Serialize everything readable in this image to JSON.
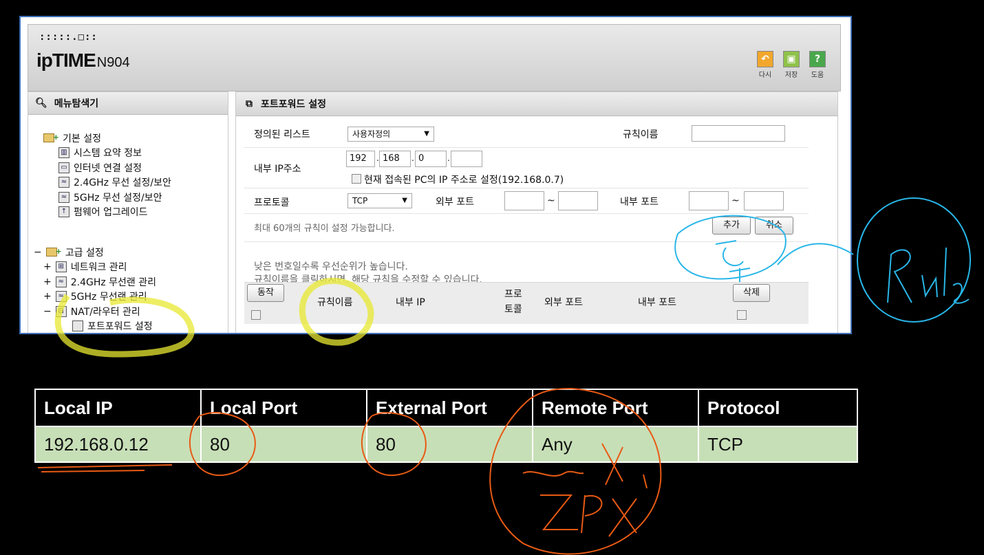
{
  "router": {
    "logo_small": ":::::.□::",
    "brand": "ipTIME",
    "model": "N904",
    "toolbar": [
      {
        "label": "다시",
        "icon": "undo-icon"
      },
      {
        "label": "저장",
        "icon": "save-icon"
      },
      {
        "label": "도움",
        "icon": "help-icon"
      }
    ],
    "menu_title": "메뉴탐색기",
    "menu": {
      "basic": {
        "label": "기본 설정",
        "items": [
          "시스템 요약 정보",
          "인터넷 연결 설정",
          "2.4GHz 무선 설정/보안",
          "5GHz 무선 설정/보안",
          "펌웨어 업그레이드"
        ]
      },
      "advanced": {
        "label": "고급 설정",
        "items": [
          "네트워크 관리",
          "2.4GHz 무선랜 관리",
          "5GHz 무선랜 관리",
          "NAT/라우터 관리"
        ],
        "sub_item": "포트포워드 설정"
      }
    },
    "panel_title": "포트포워드 설정",
    "form": {
      "predefined_label": "정의된 리스트",
      "predefined_value": "사용자정의",
      "rule_name_label": "규칙이름",
      "internal_ip_label": "내부 IP주소",
      "ip": [
        "192",
        "168",
        "0",
        ""
      ],
      "current_pc_checkbox": "현재 접속된 PC의 IP 주소로 설정(192.168.0.7)",
      "protocol_label": "프로토콜",
      "protocol_value": "TCP",
      "external_port_label": "외부 포트",
      "internal_port_label": "내부 포트",
      "tilde": "~",
      "max_rules_note": "최대 60개의 규칙이 설정 가능합니다.",
      "add_button": "추가",
      "cancel_button": "취소",
      "priority_note": "낮은 번호일수록 우선순위가 높습니다.",
      "edit_note": "규칙이름을 클릭하시면, 해당 규칙을 수정할 수 있습니다."
    },
    "table_headers": {
      "action_button": "동작",
      "rule_name": "규칙이름",
      "internal_ip": "내부 IP",
      "protocol_line1": "프로",
      "protocol_line2": "토콜",
      "external_port": "외부 포트",
      "internal_port": "내부 포트",
      "delete_button": "삭제"
    }
  },
  "summary_table": {
    "headers": [
      "Local IP",
      "Local Port",
      "External Port",
      "Remote Port",
      "Protocol"
    ],
    "row": [
      "192.168.0.12",
      "80",
      "80",
      "Any",
      "TCP"
    ]
  },
  "colors": {
    "frame_border": "#3e6fb8",
    "table_row": "#c7dfb7",
    "highlight_yellow": "#e8e832",
    "annotation_blue": "#29b6e8",
    "annotation_orange": "#e85a14"
  }
}
